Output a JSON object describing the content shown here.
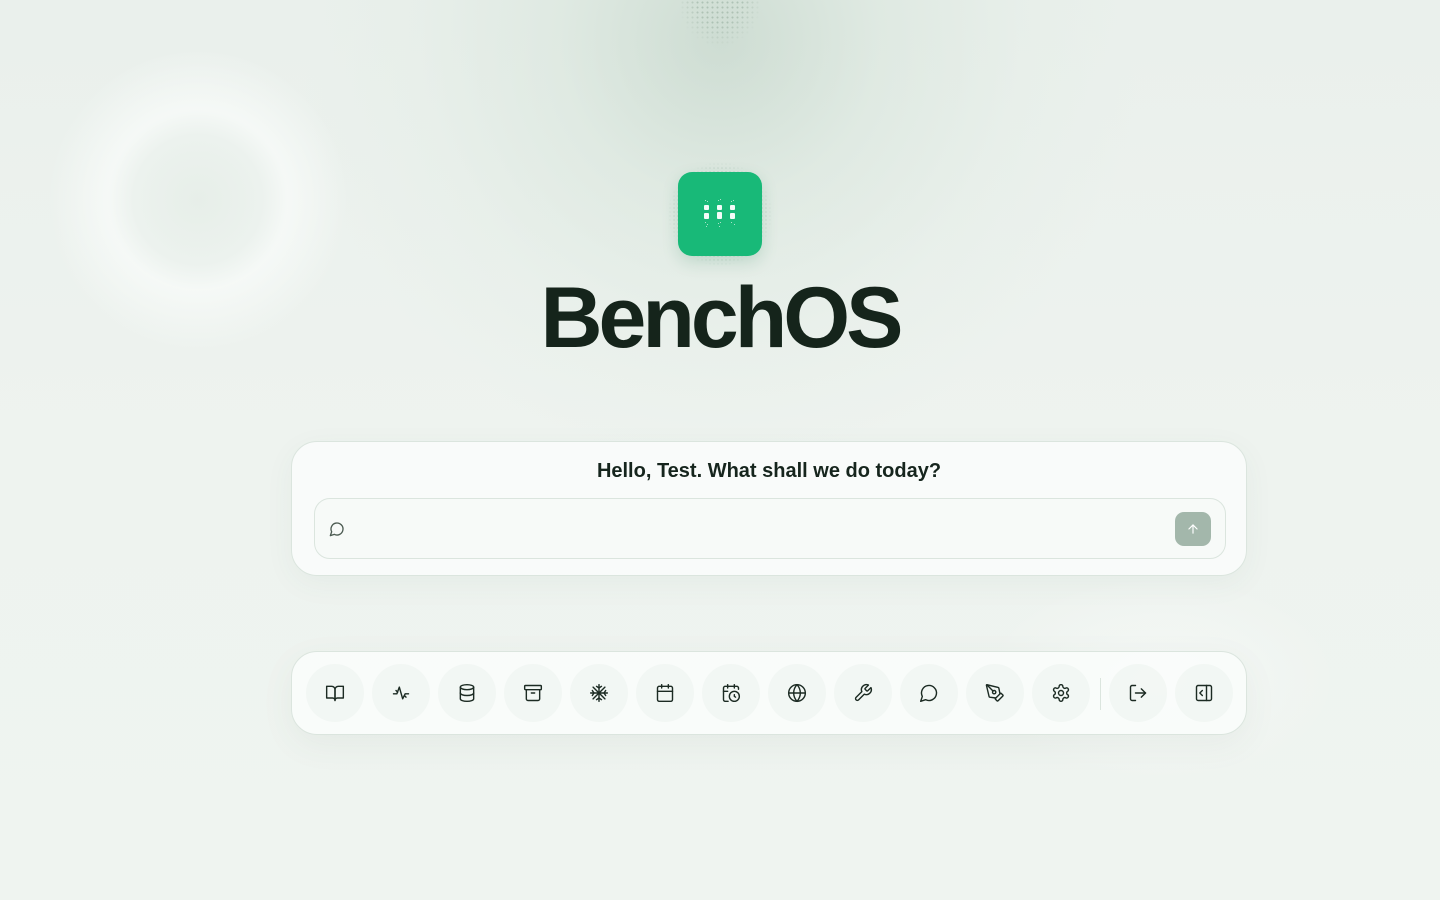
{
  "app": {
    "name": "BenchOS",
    "accent": "#18b978"
  },
  "chat": {
    "greeting": "Hello, Test. What shall we do today?",
    "input_value": "",
    "input_placeholder": "",
    "send_icon": "arrow-up-icon",
    "input_icon": "message-circle-icon"
  },
  "dock": {
    "items": [
      {
        "id": "book",
        "icon": "book-open-icon"
      },
      {
        "id": "activity",
        "icon": "activity-icon"
      },
      {
        "id": "database",
        "icon": "database-icon"
      },
      {
        "id": "archive",
        "icon": "archive-icon"
      },
      {
        "id": "snowflake",
        "icon": "snowflake-icon"
      },
      {
        "id": "calendar",
        "icon": "calendar-icon"
      },
      {
        "id": "calendar-clock",
        "icon": "calendar-clock-icon"
      },
      {
        "id": "globe",
        "icon": "globe-icon"
      },
      {
        "id": "wrench",
        "icon": "wrench-icon"
      },
      {
        "id": "chat",
        "icon": "message-circle-icon"
      },
      {
        "id": "pen",
        "icon": "pen-tool-icon"
      },
      {
        "id": "settings",
        "icon": "gear-icon"
      },
      {
        "id": "logout",
        "icon": "log-out-icon"
      },
      {
        "id": "sidebar",
        "icon": "panel-left-icon"
      }
    ]
  }
}
